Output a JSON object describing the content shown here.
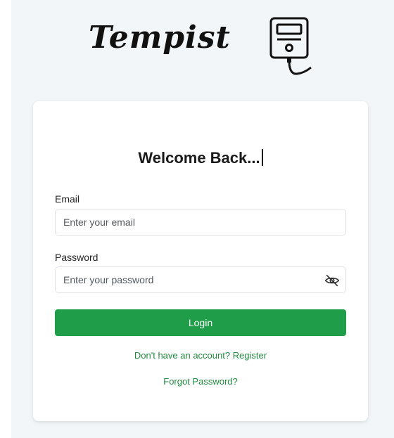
{
  "brand": {
    "name": "Tempist",
    "logo_icon": "meter-device-icon"
  },
  "login": {
    "title": "Welcome Back...",
    "email": {
      "label": "Email",
      "placeholder": "Enter your email",
      "value": ""
    },
    "password": {
      "label": "Password",
      "placeholder": "Enter your password",
      "value": "",
      "toggle_icon": "eye-off-icon"
    },
    "submit_label": "Login",
    "register_link": "Don't have an account? Register",
    "forgot_link": "Forgot Password?"
  },
  "colors": {
    "primary": "#1f9d48",
    "link": "#1f8a3e",
    "page_background": "#f3f6f9",
    "card_background": "#ffffff"
  }
}
